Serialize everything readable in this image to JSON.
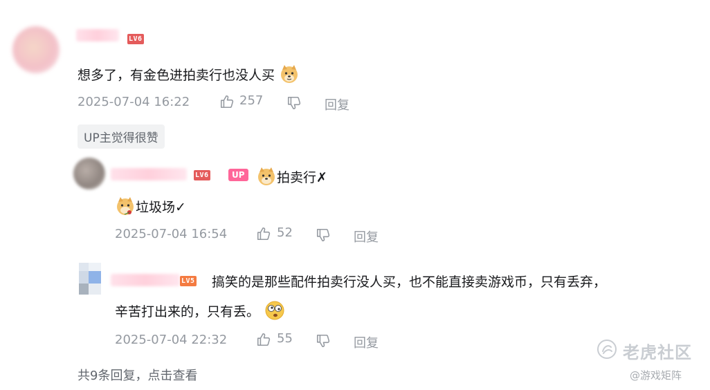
{
  "colors": {
    "text": "#18191c",
    "meta": "#9499a0",
    "up_tag": "#ff6699",
    "lv_red": "#e45b5b",
    "lv_orange": "#f47b41"
  },
  "comments": [
    {
      "level": "LV6",
      "text": "想多了，有金色进拍卖行也没人买",
      "time": "2025-07-04 16:22",
      "likes": "257",
      "reply_label": "回复",
      "badge": "UP主觉得很赞",
      "emoji": "doge-emoji"
    }
  ],
  "replies": [
    {
      "level": "LV6",
      "up_tag": "UP",
      "line1_text": "拍卖行✗",
      "line2_text": "垃圾场✓",
      "time": "2025-07-04 16:54",
      "likes": "52",
      "reply_label": "回复"
    },
    {
      "level": "LV5",
      "line1_text": "搞笑的是那些配件拍卖行没人买，也不能直接卖游戏币，只有丢弃，",
      "line2_text": "辛苦打出来的，只有丢。",
      "time": "2025-07-04 22:32",
      "likes": "55",
      "reply_label": "回复",
      "emoji": "dizzy-face-emoji"
    }
  ],
  "footer": {
    "reply_count": "共9条回复，点击查看"
  },
  "watermark": {
    "main": "老虎社区",
    "sub": "@游戏矩阵"
  }
}
